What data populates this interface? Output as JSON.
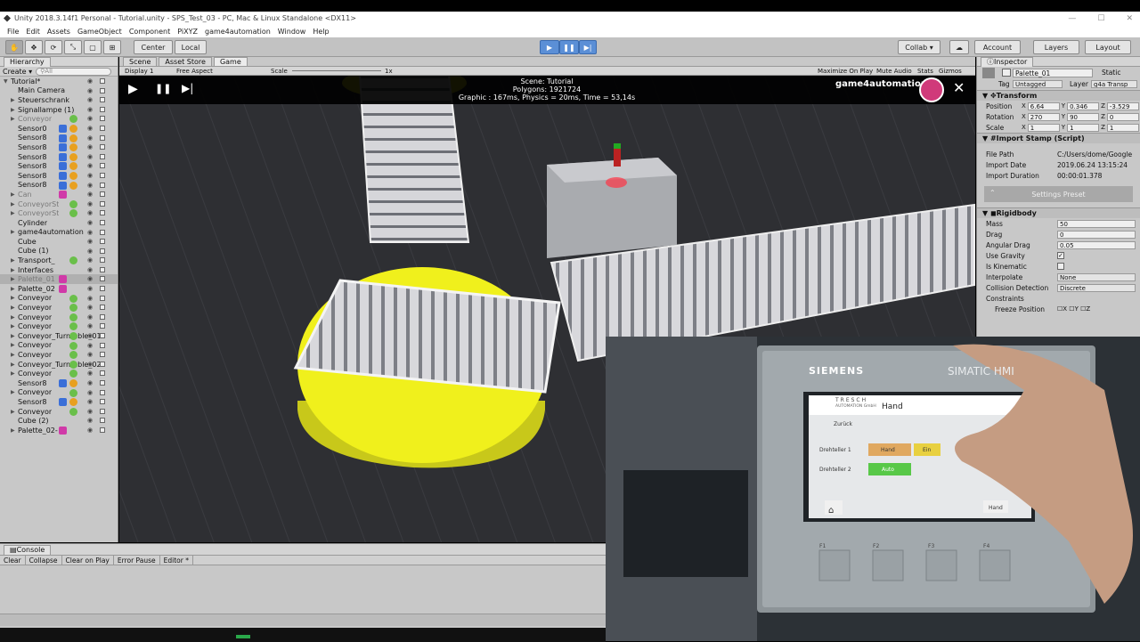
{
  "window": {
    "title": "Unity 2018.3.14f1 Personal - Tutorial.unity - SPS_Test_03 - PC, Mac & Linux Standalone <DX11>"
  },
  "menu": [
    "File",
    "Edit",
    "Assets",
    "GameObject",
    "Component",
    "PiXYZ",
    "game4automation",
    "Window",
    "Help"
  ],
  "toolbar": {
    "pivot": "Center",
    "space": "Local",
    "collab": "Collab ▾",
    "account": "Account",
    "layers": "Layers",
    "layout": "Layout"
  },
  "hierarchy": {
    "tab": "Hierarchy",
    "create": "Create ▾",
    "search_placeholder": "All",
    "items": [
      {
        "label": "Tutorial*",
        "depth": 0,
        "arrow": "▼",
        "dim": false,
        "sel": false
      },
      {
        "label": "Main Camera",
        "depth": 1,
        "arrow": "",
        "dim": false,
        "sel": false
      },
      {
        "label": "Steuerschrank",
        "depth": 1,
        "arrow": "▶",
        "dim": false,
        "sel": false
      },
      {
        "label": "Signallampe (1)",
        "depth": 1,
        "arrow": "▶",
        "dim": false,
        "sel": false
      },
      {
        "label": "Conveyor",
        "depth": 1,
        "arrow": "▶",
        "dim": true,
        "sel": false
      },
      {
        "label": "Sensor0",
        "depth": 1,
        "arrow": "",
        "dim": false,
        "sel": false
      },
      {
        "label": "Sensor8",
        "depth": 1,
        "arrow": "",
        "dim": false,
        "sel": false
      },
      {
        "label": "Sensor8",
        "depth": 1,
        "arrow": "",
        "dim": false,
        "sel": false
      },
      {
        "label": "Sensor8",
        "depth": 1,
        "arrow": "",
        "dim": false,
        "sel": false
      },
      {
        "label": "Sensor8",
        "depth": 1,
        "arrow": "",
        "dim": false,
        "sel": false
      },
      {
        "label": "Sensor8",
        "depth": 1,
        "arrow": "",
        "dim": false,
        "sel": false
      },
      {
        "label": "Sensor8",
        "depth": 1,
        "arrow": "",
        "dim": false,
        "sel": false
      },
      {
        "label": "Can",
        "depth": 1,
        "arrow": "▶",
        "dim": true,
        "sel": false
      },
      {
        "label": "ConveyorSt",
        "depth": 1,
        "arrow": "▶",
        "dim": true,
        "sel": false
      },
      {
        "label": "ConveyorSt",
        "depth": 1,
        "arrow": "▶",
        "dim": true,
        "sel": false
      },
      {
        "label": "Cylinder",
        "depth": 1,
        "arrow": "",
        "dim": false,
        "sel": false
      },
      {
        "label": "game4automation",
        "depth": 1,
        "arrow": "▶",
        "dim": false,
        "sel": false
      },
      {
        "label": "Cube",
        "depth": 1,
        "arrow": "",
        "dim": false,
        "sel": false
      },
      {
        "label": "Cube (1)",
        "depth": 1,
        "arrow": "",
        "dim": false,
        "sel": false
      },
      {
        "label": "Transport_",
        "depth": 1,
        "arrow": "▶",
        "dim": false,
        "sel": false
      },
      {
        "label": "Interfaces",
        "depth": 1,
        "arrow": "▶",
        "dim": false,
        "sel": false
      },
      {
        "label": "Palette_01",
        "depth": 1,
        "arrow": "▶",
        "dim": true,
        "sel": true
      },
      {
        "label": "Palette_02",
        "depth": 1,
        "arrow": "▶",
        "dim": false,
        "sel": false
      },
      {
        "label": "Conveyor",
        "depth": 1,
        "arrow": "▶",
        "dim": false,
        "sel": false
      },
      {
        "label": "Conveyor",
        "depth": 1,
        "arrow": "▶",
        "dim": false,
        "sel": false
      },
      {
        "label": "Conveyor",
        "depth": 1,
        "arrow": "▶",
        "dim": false,
        "sel": false
      },
      {
        "label": "Conveyor",
        "depth": 1,
        "arrow": "▶",
        "dim": false,
        "sel": false
      },
      {
        "label": "Conveyor_Turntable_01",
        "depth": 1,
        "arrow": "▶",
        "dim": false,
        "sel": false
      },
      {
        "label": "Conveyor",
        "depth": 1,
        "arrow": "▶",
        "dim": false,
        "sel": false
      },
      {
        "label": "Conveyor",
        "depth": 1,
        "arrow": "▶",
        "dim": false,
        "sel": false
      },
      {
        "label": "Conveyor_Turntable_02",
        "depth": 1,
        "arrow": "▶",
        "dim": false,
        "sel": false
      },
      {
        "label": "Conveyor",
        "depth": 1,
        "arrow": "▶",
        "dim": false,
        "sel": false
      },
      {
        "label": "Sensor8",
        "depth": 1,
        "arrow": "",
        "dim": false,
        "sel": false
      },
      {
        "label": "Conveyor",
        "depth": 1,
        "arrow": "▶",
        "dim": false,
        "sel": false
      },
      {
        "label": "Sensor8",
        "depth": 1,
        "arrow": "",
        "dim": false,
        "sel": false
      },
      {
        "label": "Conveyor",
        "depth": 1,
        "arrow": "▶",
        "dim": false,
        "sel": false
      },
      {
        "label": "Cube (2)",
        "depth": 1,
        "arrow": "",
        "dim": false,
        "sel": false
      },
      {
        "label": "Palette_02-",
        "depth": 1,
        "arrow": "▶",
        "dim": false,
        "sel": false
      }
    ]
  },
  "game": {
    "tabs": [
      "Scene",
      "Asset Store",
      "Game"
    ],
    "display": "Display 1",
    "aspect": "Free Aspect",
    "scale_label": "Scale",
    "scale_value": "1x",
    "options": [
      "Maximize On Play",
      "Mute Audio",
      "Stats",
      "Gizmos"
    ],
    "hud": {
      "scene": "Scene: Tutorial",
      "polygons": "Polygons: 1921724",
      "perf": "Graphic : 167ms, Physics = 20ms, Time = 53,14s",
      "brand": "game4automation"
    }
  },
  "inspector": {
    "tab": "Inspector",
    "name": "Palette_01",
    "static": "Static",
    "tag_label": "Tag",
    "tag": "Untagged",
    "layer_label": "Layer",
    "layer": "g4a Transp",
    "transform": {
      "title": "Transform",
      "position": [
        "6.64",
        "0.346",
        "-3.529"
      ],
      "rotation": [
        "270",
        "90",
        "0"
      ],
      "scale": [
        "1",
        "1",
        "1"
      ]
    },
    "import_stamp": {
      "title": "Import Stamp (Script)",
      "file_path_label": "File Path",
      "file_path": "C:/Users/dome/Google",
      "import_date_label": "Import Date",
      "import_date": "2019.06.24 13:15:24",
      "import_duration_label": "Import Duration",
      "import_duration": "00:00:01.378",
      "preset": "Settings Preset"
    },
    "rigidbody": {
      "title": "Rigidbody",
      "mass_label": "Mass",
      "mass": "50",
      "drag_label": "Drag",
      "drag": "0",
      "angular_drag_label": "Angular Drag",
      "angular_drag": "0.05",
      "use_gravity_label": "Use Gravity",
      "is_kinematic_label": "Is Kinematic",
      "interpolate_label": "Interpolate",
      "interpolate": "None",
      "collision_label": "Collision Detection",
      "collision": "Discrete",
      "constraints_label": "Constraints",
      "freeze_label": "Freeze Position"
    }
  },
  "console": {
    "tab": "Console",
    "buttons": [
      "Clear",
      "Collapse",
      "Clear on Play",
      "Error Pause",
      "Editor *"
    ]
  },
  "hmi": {
    "brand": "SIEMENS",
    "model": "SIMATIC HMI",
    "company": "TRESCH",
    "company_sub": "AUTOMATION GmbH",
    "screen_title": "Hand",
    "back": "Zurück",
    "row1": "Drehteller 1",
    "row2": "Drehteller 2",
    "btn_hand": "Hand",
    "btn_ein": "Ein",
    "btn_auto": "Auto",
    "btn_hand2": "Hand",
    "fkeys": [
      "F1",
      "F2",
      "F3",
      "F4"
    ]
  }
}
